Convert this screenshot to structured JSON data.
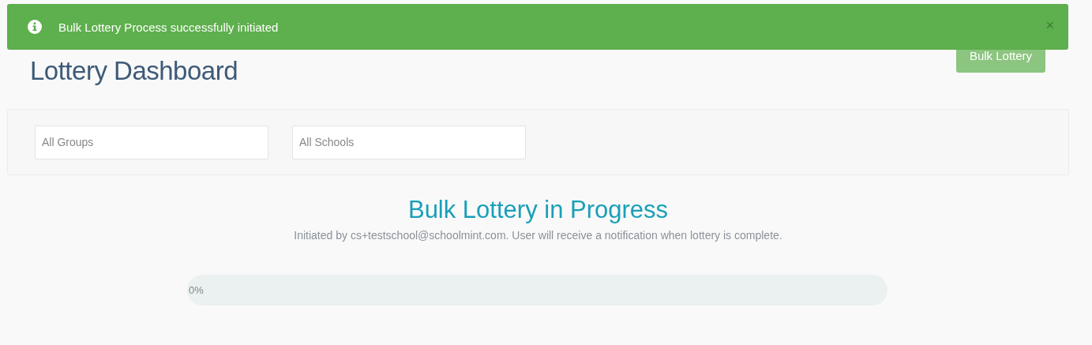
{
  "toast": {
    "message": "Bulk Lottery Process successfully initiated",
    "close": "×"
  },
  "page_title": "Lottery Dashboard",
  "action_button": "Bulk Lottery",
  "filters": [
    {
      "placeholder": "All Groups"
    },
    {
      "placeholder": "All Schools"
    }
  ],
  "status": {
    "heading": "Bulk Lottery in Progress",
    "subtitle": "Initiated by cs+testschool@schoolmint.com. User will receive a notification when lottery is complete."
  },
  "progress": {
    "reading": "0%"
  }
}
